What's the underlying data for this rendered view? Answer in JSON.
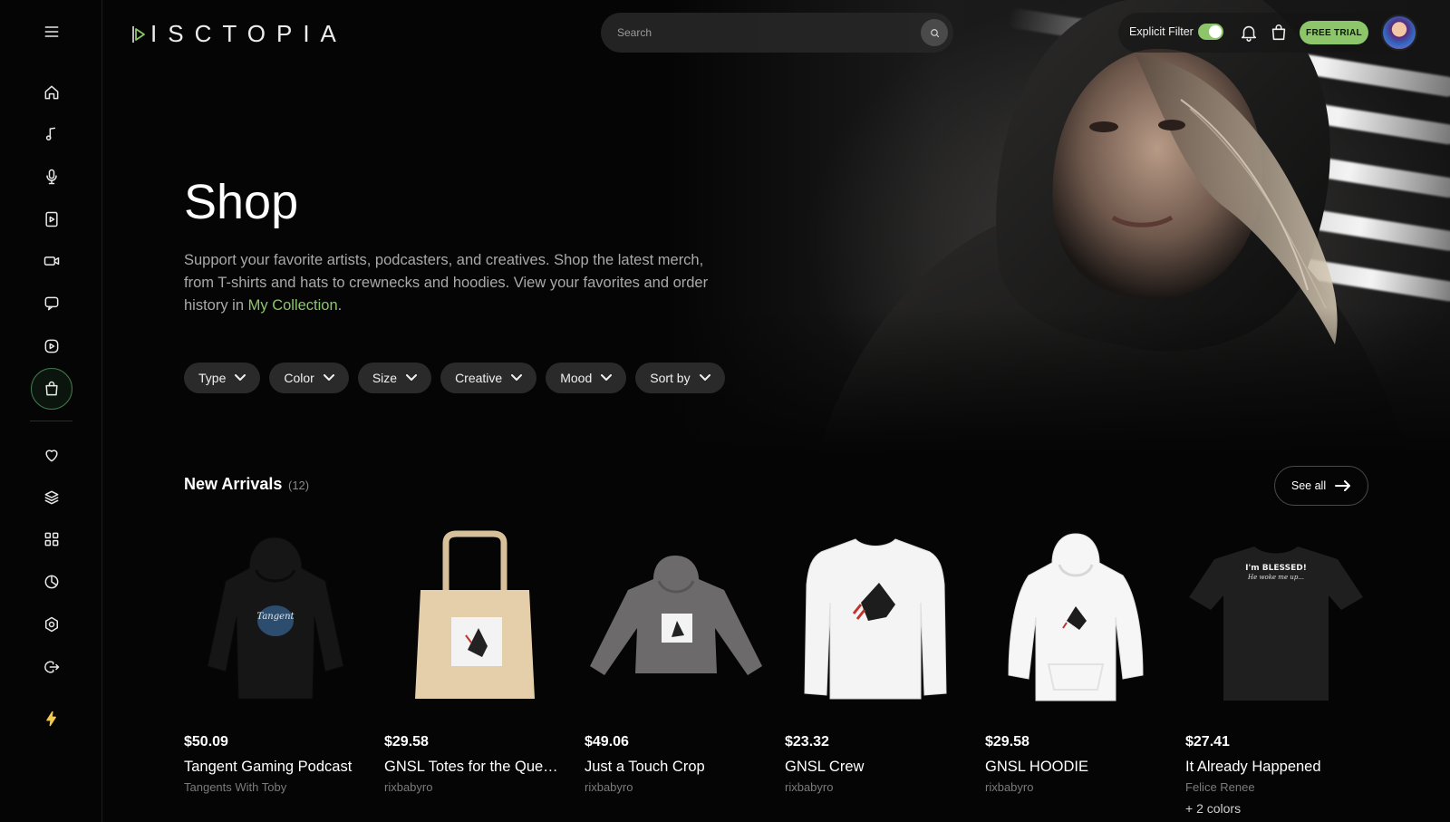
{
  "app": {
    "logo_text": "ISCTOPIA"
  },
  "search": {
    "placeholder": "Search"
  },
  "topbar": {
    "explicit_label": "Explicit Filter",
    "explicit_on": true,
    "trial_label": "FREE TRIAL"
  },
  "hero": {
    "title": "Shop",
    "description": "Support your favorite artists, podcasters, and creatives. Shop the latest merch, from T-shirts and hats to crewnecks and hoodies. View your favorites and order history in ",
    "link": "My Collection",
    "description_end": "."
  },
  "filters": [
    "Type",
    "Color",
    "Size",
    "Creative",
    "Mood",
    "Sort by"
  ],
  "section": {
    "title": "New Arrivals",
    "count": "(12)",
    "see_all": "See all"
  },
  "products": [
    {
      "price": "$50.09",
      "name": "Tangent Gaming Podcast",
      "creator": "Tangents With Toby",
      "extra": "",
      "kind": "hoodie-black"
    },
    {
      "price": "$29.58",
      "name": "GNSL Totes for the Que…",
      "creator": "rixbabyro",
      "extra": "",
      "kind": "tote"
    },
    {
      "price": "$49.06",
      "name": "Just a Touch Crop",
      "creator": "rixbabyro",
      "extra": "",
      "kind": "crop-grey"
    },
    {
      "price": "$23.32",
      "name": "GNSL Crew",
      "creator": "rixbabyro",
      "extra": "",
      "kind": "crew-white"
    },
    {
      "price": "$29.58",
      "name": "GNSL HOODIE",
      "creator": "rixbabyro",
      "extra": "",
      "kind": "hoodie-white"
    },
    {
      "price": "$27.41",
      "name": "It Already Happened",
      "creator": "Felice Renee",
      "extra": "+ 2 colors",
      "kind": "tee-black",
      "print_line1": "I'm BLESSED!",
      "print_line2": "He woke me up..."
    }
  ],
  "tangent_print": "Tangent",
  "colors": {
    "accent": "#8cc56a",
    "background": "#050505",
    "chip": "#2a2a2a"
  }
}
